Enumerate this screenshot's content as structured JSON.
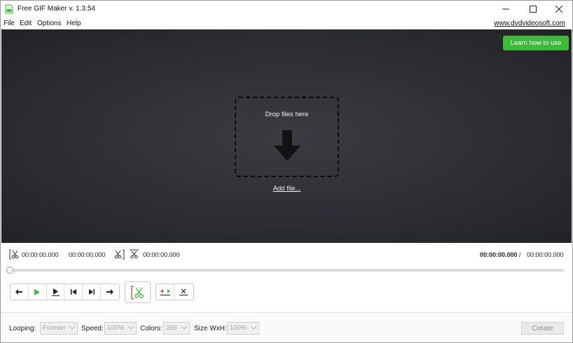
{
  "window": {
    "title": "Free GIF Maker v. 1.3.54"
  },
  "menu": {
    "items": [
      "File",
      "Edit",
      "Options",
      "Help"
    ],
    "site_link": "www.dvdvideosoft.com"
  },
  "preview": {
    "learn_button": "Learn how to use",
    "drop_text": "Drop files here",
    "add_file_link": "Add file..."
  },
  "timeline": {
    "start_time": "00:00:00.000",
    "end_time": "00:00:00.000",
    "cut_time": "00:00:00.000",
    "current_time": "00:00:00.000",
    "separator": "/",
    "total_time": "00:00:00.000",
    "position": 0
  },
  "settings": {
    "looping_label": "Looping:",
    "looping_value": "Forever",
    "speed_label": "Speed:",
    "speed_value": "100%",
    "colors_label": "Colors:",
    "colors_value": "256",
    "size_label": "Size WxH:",
    "size_value": "100%",
    "create_button": "Create"
  },
  "colors": {
    "accent_green": "#3dba3a",
    "preview_bg": "#2f3136",
    "cut_red": "#e04444"
  }
}
